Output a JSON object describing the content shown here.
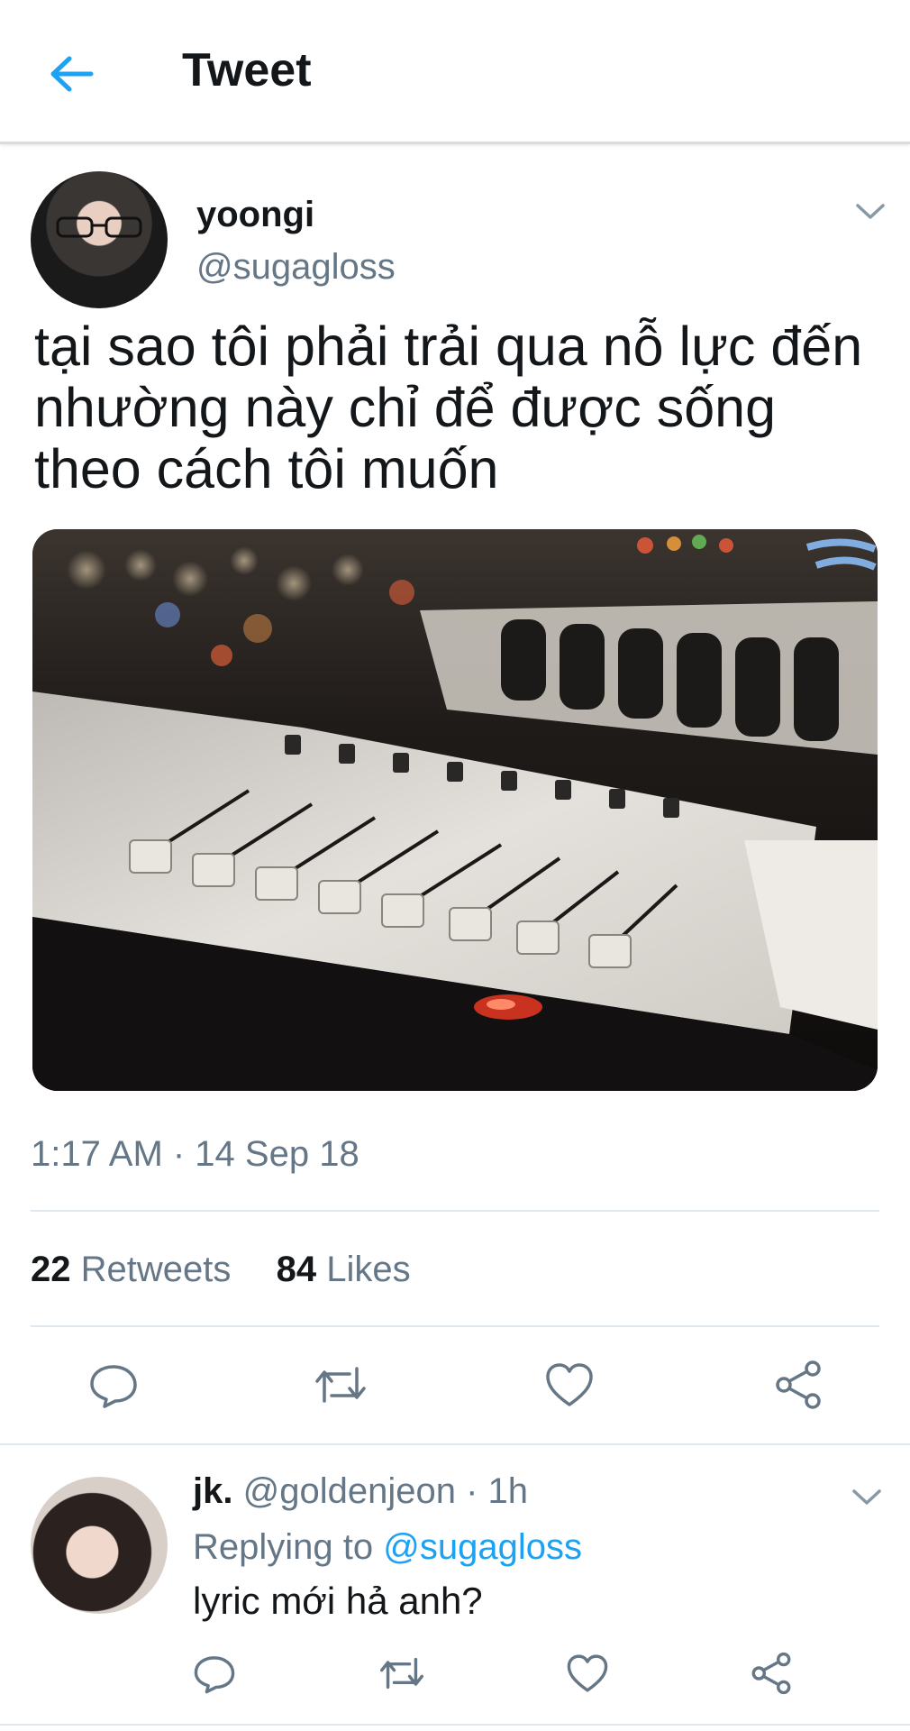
{
  "header": {
    "title": "Tweet",
    "back_icon": "arrow-left-icon",
    "accent": "#1da1f2"
  },
  "tweet": {
    "author_name": "yoongi",
    "author_handle": "@sugagloss",
    "text": "tại sao tôi phải trải qua nỗ lực đến nhường này chỉ để được sống theo cách tôi muốn",
    "media_description": "",
    "timestamp": "1:17 AM · 14 Sep 18",
    "retweet_count": "22",
    "retweet_label": "Retweets",
    "like_count": "84",
    "like_label": "Likes",
    "actions": [
      "reply-icon",
      "retweet-icon",
      "like-icon",
      "share-icon"
    ]
  },
  "reply": {
    "author_name": "jk.",
    "meta": "@goldenjeon · 1h",
    "replying_prefix": "Replying to",
    "replying_to": "@sugagloss",
    "text": "lyric mới hả anh?",
    "actions": [
      "reply-icon",
      "retweet-icon",
      "like-icon",
      "share-icon"
    ]
  },
  "colors": {
    "secondary_text": "#657786",
    "primary_text": "#14171a",
    "divider": "#e1e8ed"
  }
}
